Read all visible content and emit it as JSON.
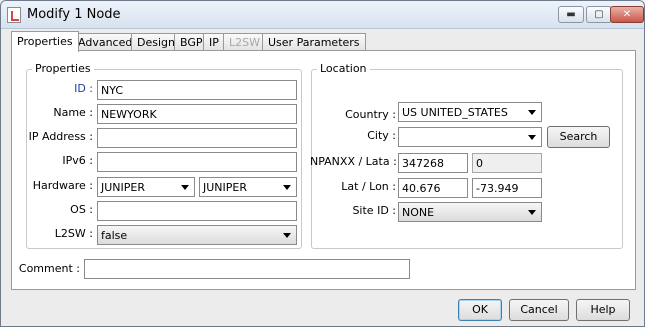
{
  "window": {
    "title": "Modify 1 Node",
    "minimize_glyph": "▬",
    "maximize_glyph": "▢",
    "close_glyph": "✕"
  },
  "tabs": [
    {
      "label": "Properties",
      "state": "active"
    },
    {
      "label": "Advanced",
      "state": "normal"
    },
    {
      "label": "Design",
      "state": "normal"
    },
    {
      "label": "BGP",
      "state": "normal"
    },
    {
      "label": "IP",
      "state": "normal"
    },
    {
      "label": "L2SW",
      "state": "disabled"
    },
    {
      "label": "User Parameters",
      "state": "normal"
    }
  ],
  "properties": {
    "group_title": "Properties",
    "id": {
      "label": "ID :",
      "value": "NYC"
    },
    "name": {
      "label": "Name :",
      "value": "NEWYORK"
    },
    "ip_address": {
      "label": "IP Address :",
      "value": ""
    },
    "ipv6": {
      "label": "IPv6 :",
      "value": ""
    },
    "hardware": {
      "label": "Hardware :",
      "value1": "JUNIPER",
      "value2": "JUNIPER"
    },
    "os": {
      "label": "OS :",
      "value": ""
    },
    "l2sw": {
      "label": "L2SW :",
      "value": "false"
    }
  },
  "location": {
    "group_title": "Location",
    "country": {
      "label": "Country :",
      "value": "US UNITED_STATES"
    },
    "city": {
      "label": "City :",
      "value": ""
    },
    "search_label": "Search",
    "npanxx": {
      "label": "NPANXX / Lata :",
      "value1": "347268",
      "value2": "0"
    },
    "latlon": {
      "label": "Lat / Lon :",
      "lat": "40.676",
      "lon": "-73.949"
    },
    "site_id": {
      "label": "Site ID :",
      "value": "NONE"
    }
  },
  "comment": {
    "label": "Comment :",
    "value": ""
  },
  "buttons": {
    "ok": "OK",
    "cancel": "Cancel",
    "help": "Help"
  },
  "colors": {
    "accent_label": "#1f3f9f",
    "title_gradient_top": "#eef3fa",
    "close_red": "#c9574a"
  }
}
